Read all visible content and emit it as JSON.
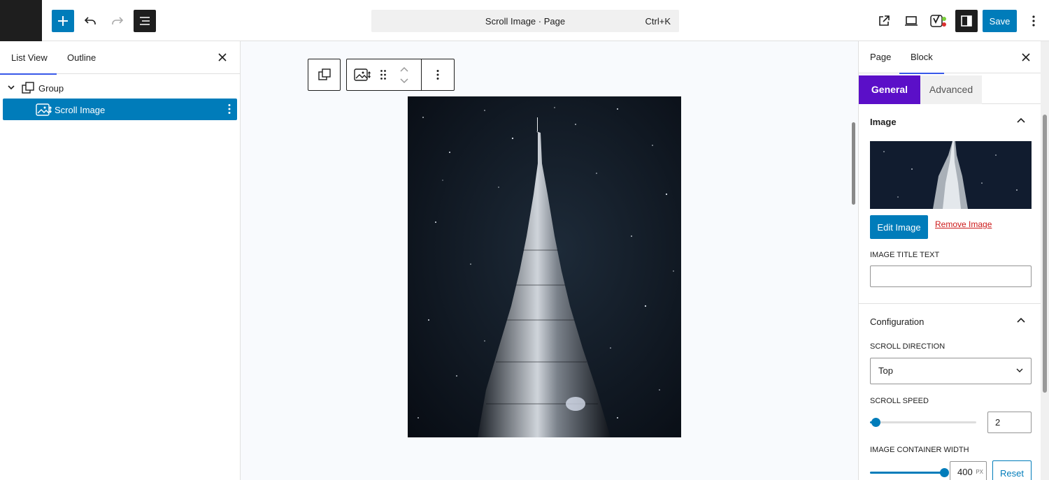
{
  "topbar": {
    "document_title": "Scroll Image · Page",
    "shortcut": "Ctrl+K",
    "save_label": "Save"
  },
  "list_panel": {
    "tabs": [
      "List View",
      "Outline"
    ],
    "active_tab": "List View",
    "tree": [
      {
        "label": "Group",
        "icon": "group-icon",
        "expanded": true
      },
      {
        "label": "Scroll Image",
        "icon": "scroll-image-icon",
        "selected": true
      }
    ]
  },
  "inspector": {
    "tabs": [
      "Page",
      "Block"
    ],
    "active_tab": "Block",
    "sub_tabs": [
      "General",
      "Advanced"
    ],
    "active_sub_tab": "General",
    "image_section": {
      "title": "Image",
      "edit_label": "Edit Image",
      "remove_label": "Remove Image",
      "title_text_label": "IMAGE TITLE TEXT",
      "title_text_value": ""
    },
    "config_section": {
      "title": "Configuration",
      "direction_label": "SCROLL DIRECTION",
      "direction_value": "Top",
      "speed_label": "SCROLL SPEED",
      "speed_value": "2",
      "speed_fraction": 0.05,
      "width_label": "IMAGE CONTAINER WIDTH",
      "width_value": "400",
      "width_unit": "PX",
      "width_fraction": 0.98,
      "reset_label": "Reset"
    }
  },
  "colors": {
    "accent": "#007cba",
    "tab_indicator": "#3858e9",
    "general_tab": "#5b0fc8",
    "danger": "#cc1818"
  }
}
